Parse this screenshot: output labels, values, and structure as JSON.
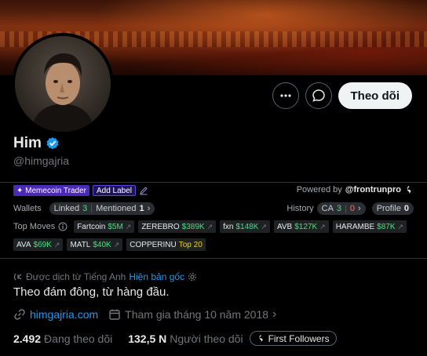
{
  "profile": {
    "name": "Him",
    "handle": "@himgajria",
    "follow_label": "Theo dõi",
    "bio": "Theo đám đông, từ hàng đầu.",
    "website": "himgajria.com",
    "joined": "Tham gia tháng 10 năm 2018",
    "following_count": "2.492",
    "following_label": "Đang theo dõi",
    "followers_count": "132,5 N",
    "followers_label": "Người theo dõi",
    "first_followers_label": "First Followers"
  },
  "translation": {
    "translated_label": "Được dịch từ Tiếng Anh",
    "show_original": "Hiện bản gốc"
  },
  "frontrun": {
    "tag_memecoin": "✦ Memecoin Trader",
    "add_label": "Add Label",
    "powered_by": "Powered by",
    "powered_brand": "@frontrunpro",
    "wallets_label": "Wallets",
    "linked_label": "Linked",
    "linked_count": "3",
    "mentioned_label": "Mentioned",
    "mentioned_count": "1",
    "history_label": "History",
    "ca_label": "CA",
    "ca_green": "3",
    "ca_red": "0",
    "profile_label": "Profile",
    "profile_count": "0",
    "top_moves_label": "Top Moves",
    "moves_row1": [
      {
        "name": "Fartcoin",
        "value": "$5M",
        "color": "green"
      },
      {
        "name": "ZEREBRO",
        "value": "$389K",
        "color": "green"
      },
      {
        "name": "fxn",
        "value": "$148K",
        "color": "green"
      },
      {
        "name": "AVB",
        "value": "$127K",
        "color": "green"
      },
      {
        "name": "HARAMBE",
        "value": "$87K",
        "color": "green"
      }
    ],
    "moves_row2": [
      {
        "name": "AVA",
        "value": "$69K",
        "color": "green"
      },
      {
        "name": "MATL",
        "value": "$40K",
        "color": "green"
      },
      {
        "name": "COPPERINU",
        "value": "Top 20",
        "color": "yellow"
      }
    ]
  },
  "colors": {
    "accent": "#1d9bf0",
    "verified": "#1d9bf0",
    "purple": "#4a2bb5"
  }
}
